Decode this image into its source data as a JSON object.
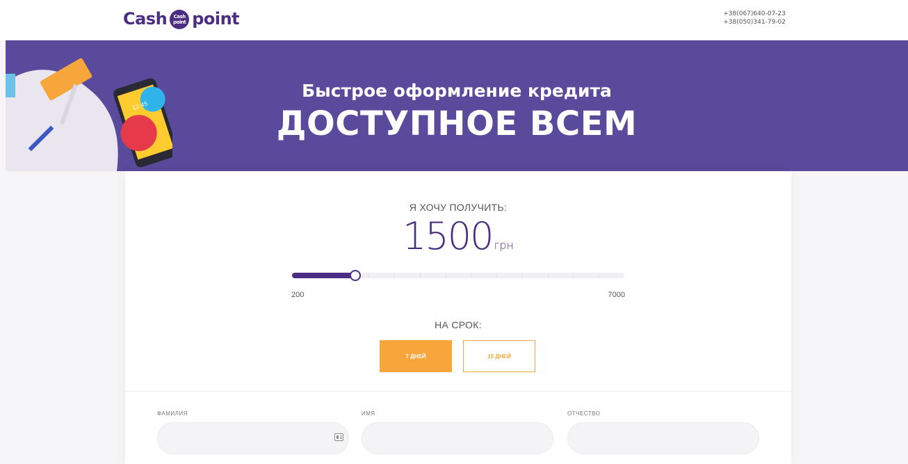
{
  "header": {
    "logo_left": "Cash",
    "logo_coin_top": "Cash",
    "logo_coin_bottom": "point",
    "logo_right": "point",
    "phone_1": "+38(067)640-07-23",
    "phone_2": "+38(050)341-79-02"
  },
  "banner": {
    "subtitle": "Быстрое оформление кредита",
    "title": "ДОСТУПНОЕ ВСЕМ",
    "phone_screen_time": "12:45"
  },
  "calculator": {
    "want_label": "Я ХОЧУ ПОЛУЧИТЬ:",
    "amount": "1500",
    "currency": "грн",
    "slider": {
      "min": 200,
      "max": 7000,
      "value": 1500,
      "min_label": "200",
      "max_label": "7000",
      "divisions": 13
    },
    "term_label": "НА СРОК:",
    "terms": [
      {
        "label": "7 ДНЕЙ",
        "active": true
      },
      {
        "label": "15 ДНЕЙ",
        "active": false
      }
    ]
  },
  "form": {
    "surname_label": "ФАМИЛИЯ",
    "surname_value": "",
    "name_label": "ИМЯ",
    "name_value": "",
    "patronymic_label": "ОТЧЕСТВО",
    "patronymic_value": ""
  },
  "colors": {
    "brand_purple": "#4b2e83",
    "banner_purple": "#5a4a9b",
    "accent_orange": "#f7a63b"
  },
  "icons": [
    "phone-illustration-icon",
    "paint-roller-icon",
    "contact-card-icon"
  ]
}
